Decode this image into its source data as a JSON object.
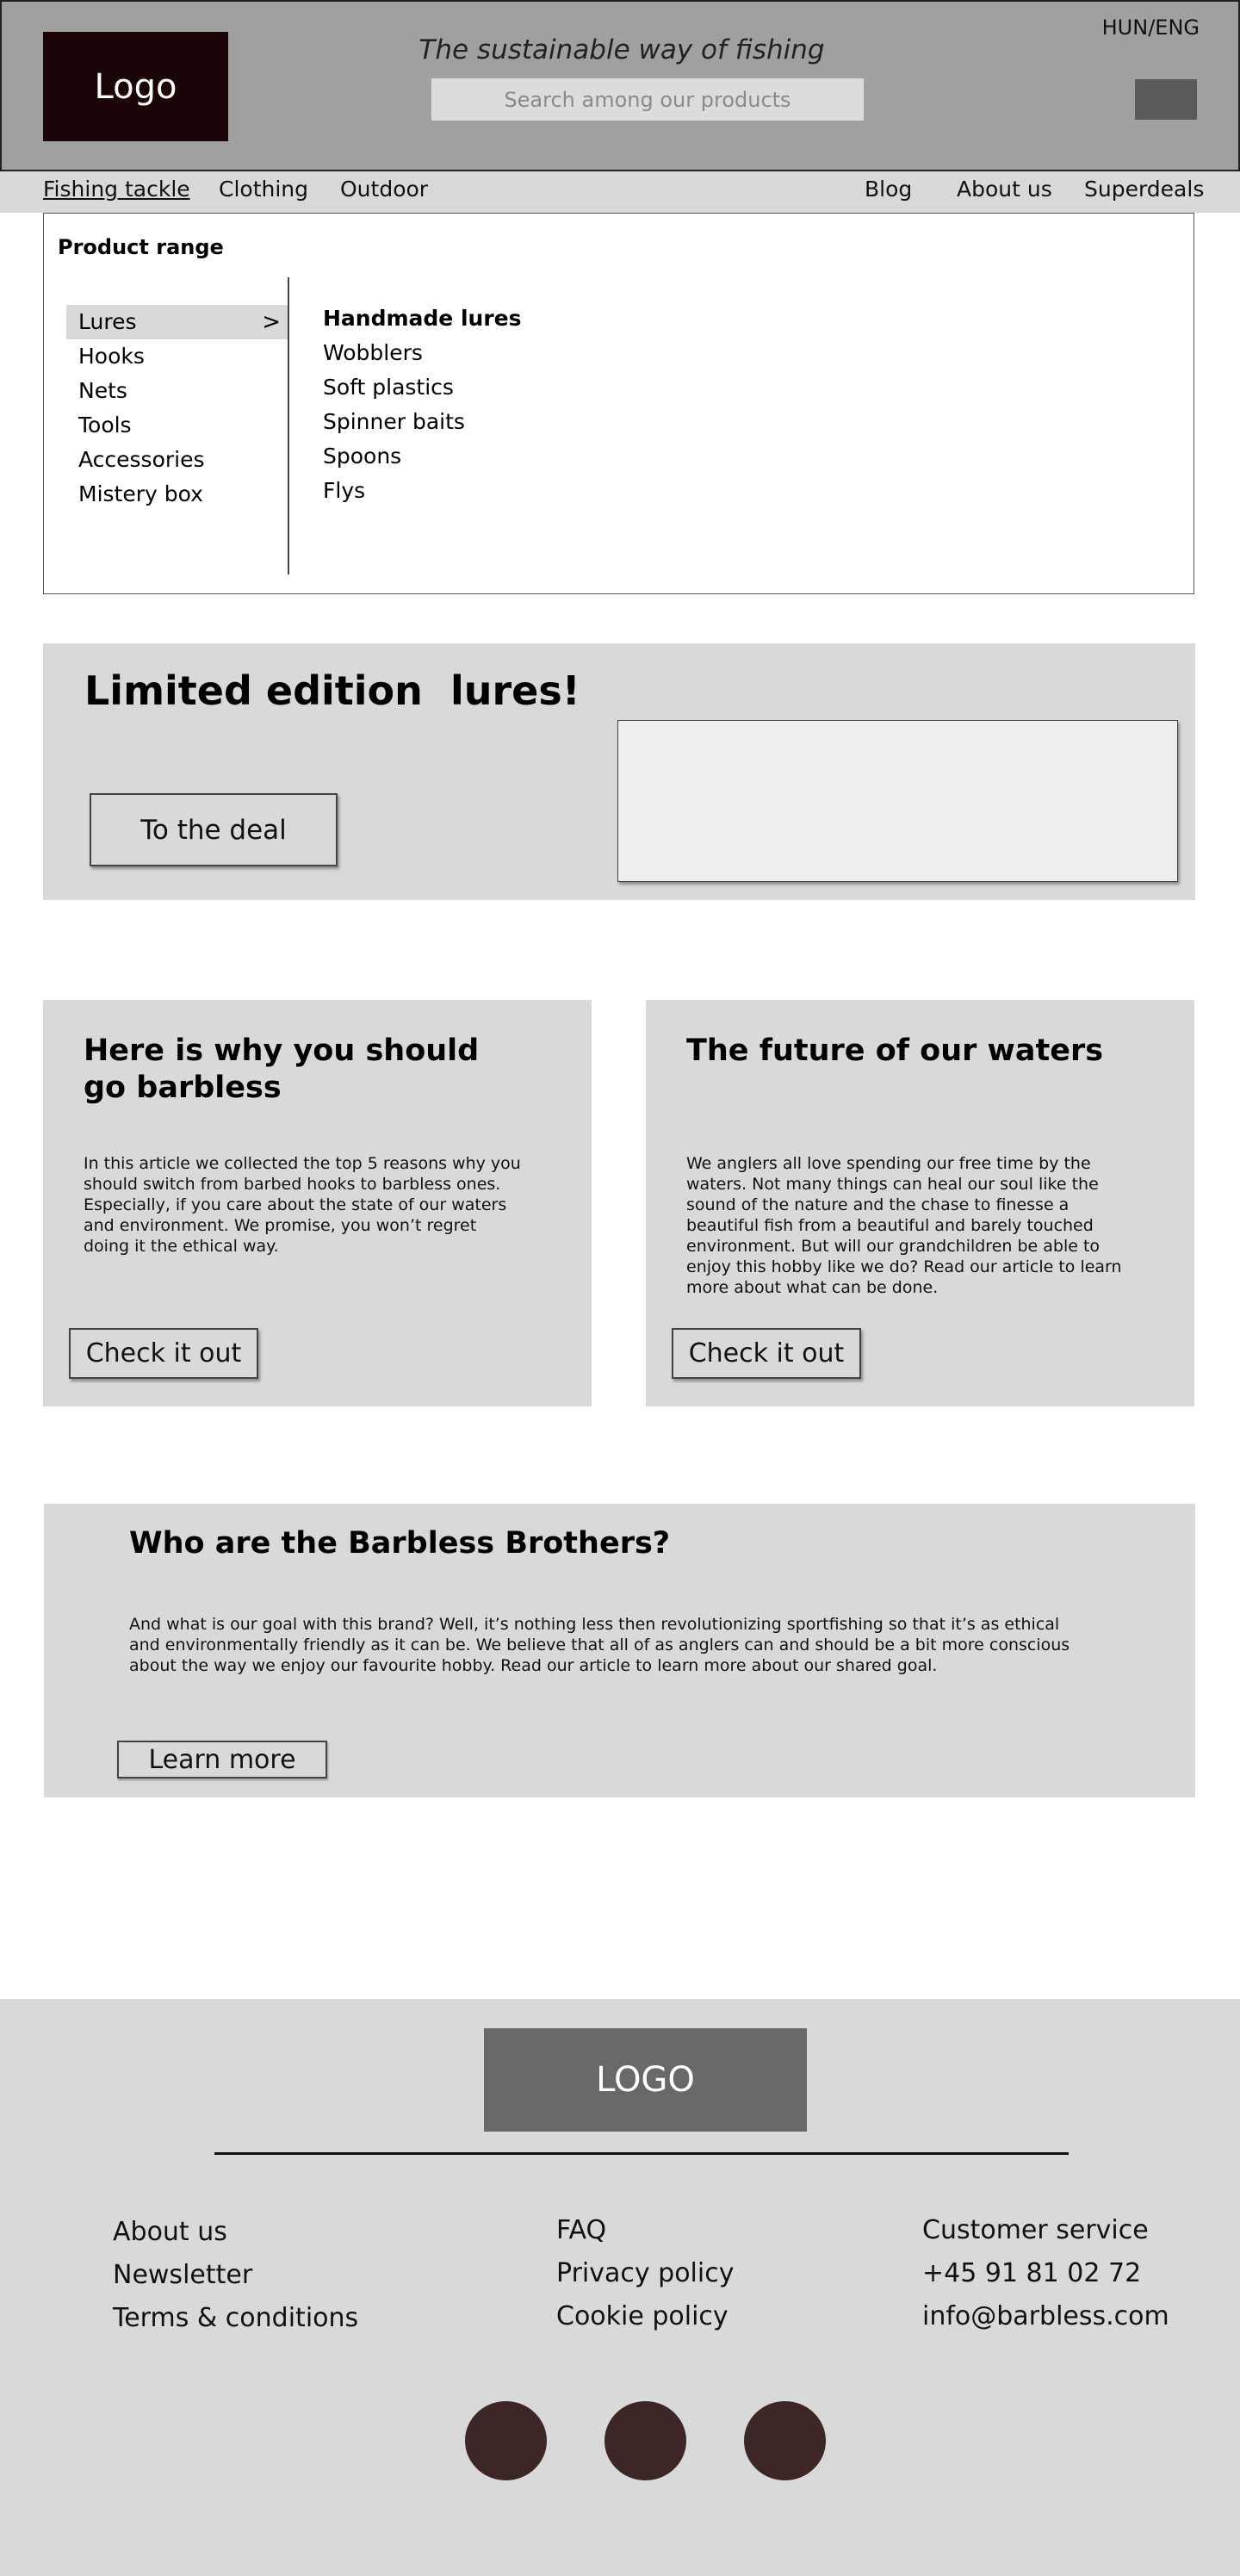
{
  "header": {
    "logo": "Logo",
    "tagline": "The sustainable way of fishing",
    "search_placeholder": "Search among our products",
    "language": "HUN/ENG"
  },
  "nav": {
    "left": [
      "Fishing tackle",
      "Clothing",
      "Outdoor"
    ],
    "right": [
      "Blog",
      "About us",
      "Superdeals"
    ],
    "active": "Fishing tackle"
  },
  "product_range": {
    "title": "Product range",
    "categories": [
      "Lures",
      "Hooks",
      "Nets",
      "Tools",
      "Accessories",
      "Mistery box"
    ],
    "active_category": "Lures",
    "active_arrow": ">",
    "subcategory_heading": "Handmade lures",
    "subcategories": [
      "Wobblers",
      "Soft plastics",
      "Spinner baits",
      "Spoons",
      "Flys"
    ]
  },
  "promo": {
    "title": "Limited edition  lures!",
    "button": "To the deal"
  },
  "articles": [
    {
      "title": "Here is why you should\ngo barbless",
      "text": "In this article we collected the top 5 reasons why you should switch from barbed hooks to barbless ones. Especially, if you care about the state of our waters and environment. We promise, you won’t regret doing it the ethical way.",
      "button": "Check it out"
    },
    {
      "title": "The future of our waters",
      "text": "We anglers all love spending our free time by the waters. Not many things can heal our soul like the sound of the nature and the chase to finesse a beautiful fish from a beautiful and barely touched environment. But will our grandchildren be able to enjoy this hobby like we do? Read our article to learn more about what can be done.",
      "button": "Check it out"
    }
  ],
  "who": {
    "title": "Who are the Barbless Brothers?",
    "text": "And what is our goal with this brand? Well, it’s nothing less then revolutionizing sportfishing so that it’s as ethical and environmentally friendly as it can be. We believe that all of as anglers can and should be a bit more conscious about the way we enjoy our favourite hobby. Read our article to learn more about our shared goal.",
    "button": "Learn more"
  },
  "footer": {
    "logo": "LOGO",
    "col1": [
      "About us",
      "Newsletter",
      "Terms & conditions"
    ],
    "col2": [
      "FAQ",
      "Privacy policy",
      "Cookie policy"
    ],
    "col3": [
      "Customer service",
      "+45 91 81 02 72",
      "info@barbless.com"
    ],
    "social_icons": [
      "social-icon-1",
      "social-icon-2",
      "social-icon-3"
    ]
  },
  "colors": {
    "header_bg": "#a0a0a0",
    "logo_bg": "#1c0508",
    "panel_bg": "#d9d9d9",
    "footer_logo_bg": "#686868",
    "social_circle": "#3c2626"
  }
}
